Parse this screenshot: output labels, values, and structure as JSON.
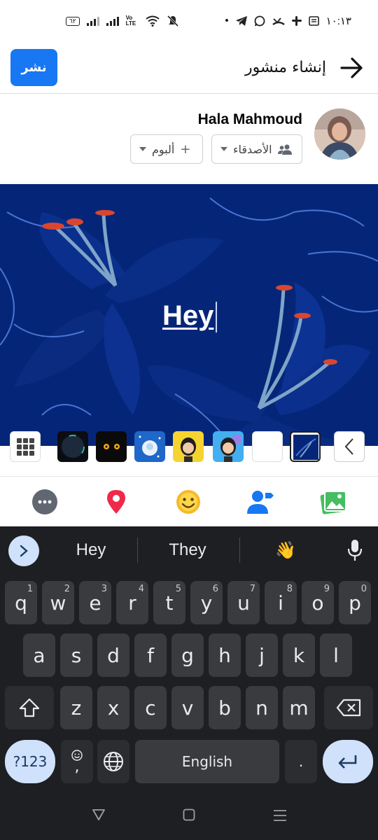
{
  "status_bar": {
    "time": "١٠:١٣",
    "battery": "٦٢",
    "network_label": "Vo\nLTE",
    "icons": [
      "battery-icon",
      "signal-icon",
      "signal-icon",
      "volte-icon",
      "wifi-icon",
      "mute-icon",
      "dot-icon",
      "telegram-icon",
      "whatsapp-icon",
      "missed-call-icon",
      "slack-icon",
      "news-icon"
    ]
  },
  "header": {
    "title": "إنشاء منشور",
    "post_button": "نشر",
    "back_icon": "arrow-right-icon"
  },
  "author": {
    "name": "Hala Mahmoud",
    "audience_label": "الأصدقاء",
    "album_label": "ألبوم",
    "album_prefix": "+"
  },
  "post": {
    "text": "Hey",
    "background_color": "#052678"
  },
  "background_picker": {
    "tiles": [
      "grid-icon",
      "dark-circle",
      "cat-eyes",
      "snow-globe",
      "emoji-avatar-yellow",
      "emoji-avatar-blue",
      "plain-white",
      "blue-lilies-selected",
      "chevron-left-icon"
    ]
  },
  "tools": [
    "more-icon",
    "location-icon",
    "emoji-icon",
    "tag-people-icon",
    "photo-icon"
  ],
  "keyboard": {
    "suggestions": [
      "Hey",
      "They",
      "👋"
    ],
    "row1": [
      {
        "k": "q",
        "n": "1"
      },
      {
        "k": "w",
        "n": "2"
      },
      {
        "k": "e",
        "n": "3"
      },
      {
        "k": "r",
        "n": "4"
      },
      {
        "k": "t",
        "n": "5"
      },
      {
        "k": "y",
        "n": "6"
      },
      {
        "k": "u",
        "n": "7"
      },
      {
        "k": "i",
        "n": "8"
      },
      {
        "k": "o",
        "n": "9"
      },
      {
        "k": "p",
        "n": "0"
      }
    ],
    "row2": [
      "a",
      "s",
      "d",
      "f",
      "g",
      "h",
      "j",
      "k",
      "l"
    ],
    "row3": [
      "z",
      "x",
      "c",
      "v",
      "b",
      "n",
      "m"
    ],
    "symbols_label": "?123",
    "comma": ",",
    "period": ".",
    "space_label": "English"
  },
  "colors": {
    "accent": "#1877f2",
    "keyboard_bg": "#1e1f22",
    "key_bg": "#3a3b3f",
    "key_blue": "#cfe1fb"
  }
}
